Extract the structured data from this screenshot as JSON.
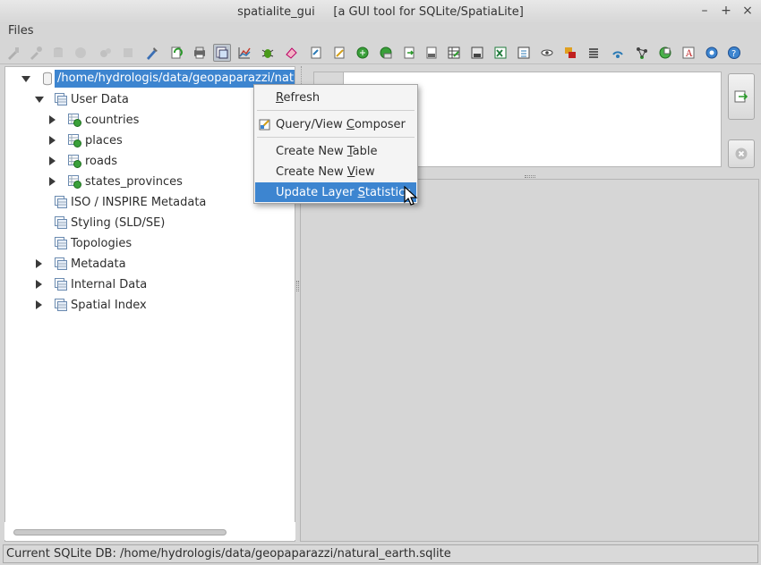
{
  "window": {
    "title": "spatialite_gui     [a GUI tool for SQLite/SpatiaLite]",
    "controls": [
      "–",
      "+",
      "×"
    ]
  },
  "menubar": {
    "files": "Files"
  },
  "tree": {
    "root_label": "/home/hydrologis/data/geopaparazzi/natural_earth.sqlite",
    "user_data": "User Data",
    "layers": [
      "countries",
      "places",
      "roads",
      "states_provinces"
    ],
    "iso_metadata": "ISO / INSPIRE Metadata",
    "styling": "Styling (SLD/SE)",
    "topologies": "Topologies",
    "metadata": "Metadata",
    "internal_data": "Internal Data",
    "spatial_index": "Spatial Index"
  },
  "context_menu": {
    "refresh": {
      "pre": "",
      "ul": "R",
      "post": "efresh"
    },
    "query_composer": {
      "pre": "Query/View ",
      "ul": "C",
      "post": "omposer"
    },
    "create_table": {
      "pre": "Create New ",
      "ul": "T",
      "post": "able"
    },
    "create_view": {
      "pre": "Create New ",
      "ul": "V",
      "post": "iew"
    },
    "update_stats": {
      "pre": "Update Layer ",
      "ul": "S",
      "post": "tatistics"
    }
  },
  "statusbar": {
    "text": "Current SQLite DB: /home/hydrologis/data/geopaparazzi/natural_earth.sqlite"
  },
  "colors": {
    "selection": "#3d85d0",
    "chrome": "#d6d6d6"
  }
}
